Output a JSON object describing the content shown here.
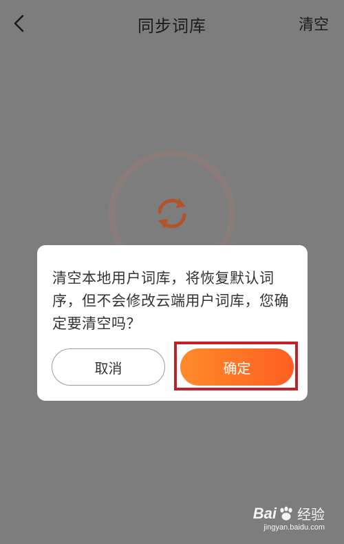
{
  "header": {
    "title": "同步词库",
    "right_action": "清空",
    "back_icon": "chevron-left-icon"
  },
  "background": {
    "sync_icon": "sync-icon"
  },
  "dialog": {
    "message": "清空本地用户词库，将恢复默认词序，但不会修改云端用户词库，您确定要清空吗？",
    "cancel_label": "取消",
    "confirm_label": "确定"
  },
  "watermark": {
    "brand": "Bai",
    "brand_suffix": "经验",
    "url": "jingyan.baidu.com"
  },
  "colors": {
    "overlay_bg": "#7d7d7d",
    "accent_orange": "#ff6f25",
    "highlight_red": "#c02027",
    "dialog_bg": "#ffffff"
  }
}
